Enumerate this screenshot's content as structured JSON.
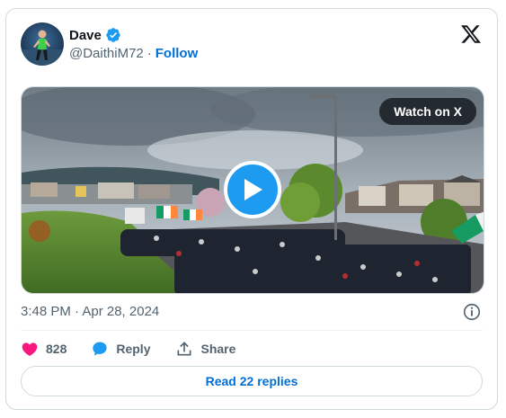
{
  "author": {
    "name": "Dave",
    "handle": "@DaithiM72",
    "follow_label": "Follow",
    "verified": true
  },
  "media": {
    "watch_label": "Watch on X"
  },
  "tweet": {
    "timestamp": "3:48 PM · Apr 28, 2024"
  },
  "actions": {
    "likes": "828",
    "reply_label": "Reply",
    "share_label": "Share"
  },
  "read_replies_label": "Read 22 replies",
  "icons": {
    "logo": "x-logo-icon",
    "verified": "verified-badge-icon",
    "play": "play-icon",
    "info": "info-icon",
    "like": "heart-icon",
    "reply": "speech-bubble-icon",
    "share": "share-upload-icon"
  },
  "colors": {
    "accent": "#1d9bf0",
    "link": "#006fd6",
    "like": "#f91880",
    "muted": "#536471"
  }
}
